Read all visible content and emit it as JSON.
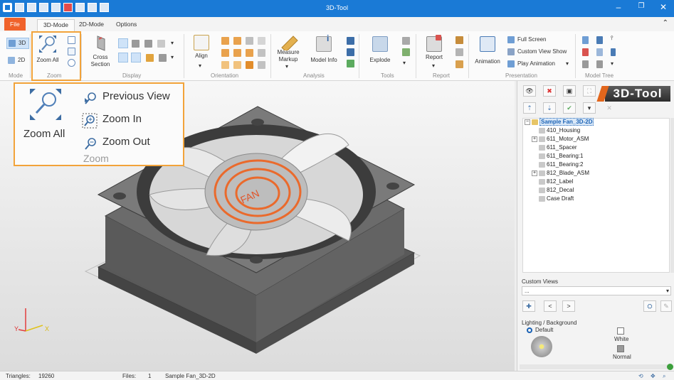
{
  "window": {
    "title": "3D-Tool",
    "minimize": "–",
    "maximize": "❐",
    "close": "✕"
  },
  "tabs": [
    {
      "label": "File"
    },
    {
      "label": "3D-Mode"
    },
    {
      "label": "2D-Mode"
    },
    {
      "label": "Options"
    }
  ],
  "ribbon": {
    "mode": {
      "label_3d": "3D",
      "label_2d": "2D",
      "group": "Mode"
    },
    "zoom": {
      "zoom_all": "Zoom All",
      "group": "Zoom"
    },
    "display": {
      "cross_section": "Cross\nSection",
      "cross_line1": "Cross",
      "cross_line2": "Section",
      "group": "Display"
    },
    "orientation": {
      "align": "Align",
      "group": "Orientation"
    },
    "analysis": {
      "measure_line1": "Measure",
      "measure_line2": "Markup",
      "model_info": "Model Info",
      "group": "Analysis"
    },
    "tools": {
      "explode": "Explode",
      "group": "Tools"
    },
    "report": {
      "report": "Report",
      "group": "Report"
    },
    "presentation": {
      "animation": "Animation",
      "full_screen": "Full Screen",
      "custom_view_show": "Custom View Show",
      "play_animation": "Play Animation",
      "group": "Presentation"
    },
    "model_tree": {
      "group": "Model Tree"
    }
  },
  "callout": {
    "zoom_all": "Zoom All",
    "previous_view": "Previous View",
    "zoom_in": "Zoom In",
    "zoom_out": "Zoom Out",
    "group": "Zoom"
  },
  "viewport": {
    "fan_label": "FAN",
    "axis_x": "X",
    "axis_y": "Y"
  },
  "panel": {
    "logo": "3D-Tool",
    "tree": [
      {
        "label": "Sample Fan_3D-2D",
        "level": 0,
        "expand": "−",
        "root": true
      },
      {
        "label": "410_Housing",
        "level": 1
      },
      {
        "label": "611_Motor_ASM",
        "level": 1,
        "expand": "+"
      },
      {
        "label": "611_Spacer",
        "level": 1
      },
      {
        "label": "611_Bearing:1",
        "level": 1
      },
      {
        "label": "611_Bearing:2",
        "level": 1
      },
      {
        "label": "812_Blade_ASM",
        "level": 1,
        "expand": "+"
      },
      {
        "label": "812_Label",
        "level": 1
      },
      {
        "label": "812_Decal",
        "level": 1
      },
      {
        "label": "Case Draft",
        "level": 1
      }
    ],
    "custom_views": {
      "label": "Custom Views",
      "select_value": "...",
      "prev": "<",
      "next": ">"
    },
    "lighting": {
      "label": "Lighting / Background",
      "default": "Default",
      "white": "White",
      "normal": "Normal"
    }
  },
  "status": {
    "triangles_label": "Triangles:",
    "triangles_value": "19260",
    "files_label": "Files:",
    "files_value": "1",
    "file_name": "Sample Fan_3D-2D"
  },
  "colors": {
    "accent": "#1a7ad6",
    "file_tab": "#f0622a",
    "highlight": "#f2a33a"
  }
}
